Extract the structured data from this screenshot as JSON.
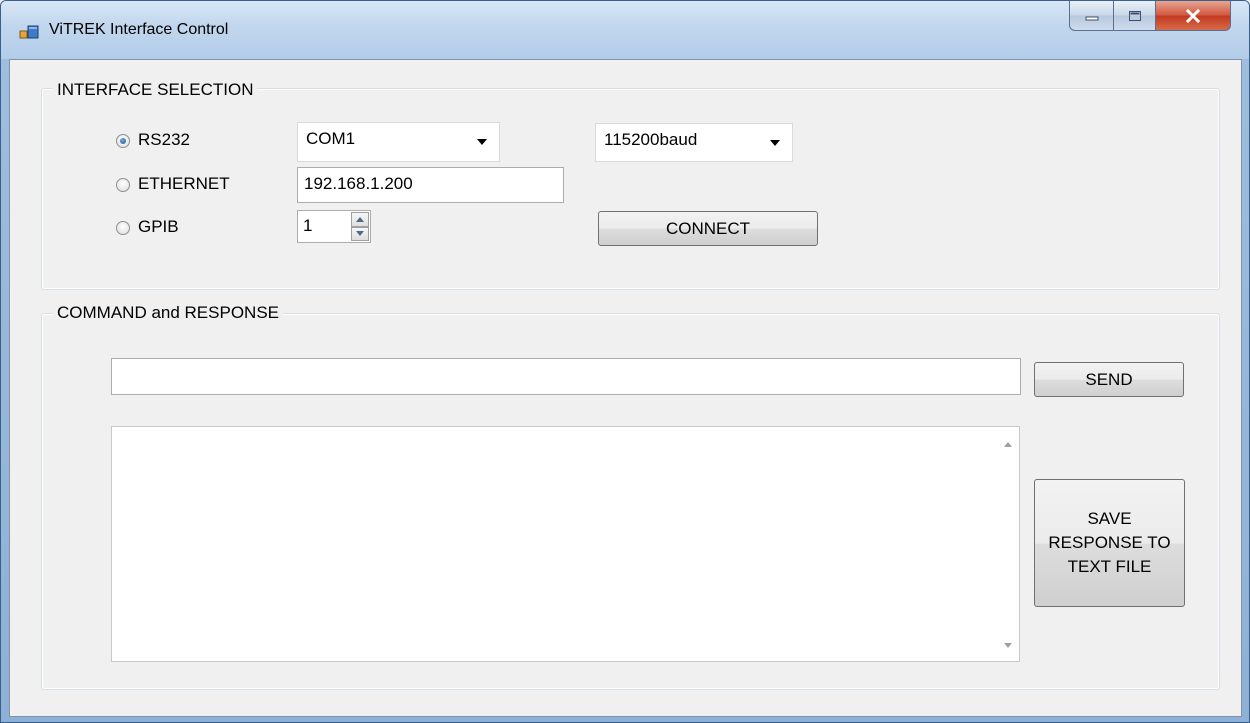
{
  "window": {
    "title": "ViTREK Interface Control",
    "accent_color": "#3a5f8a",
    "close_color": "#c23a1f"
  },
  "interface_selection": {
    "legend": "INTERFACE SELECTION",
    "rs232": {
      "label": "RS232",
      "checked": true,
      "port": "COM1",
      "baud": "115200baud"
    },
    "ethernet": {
      "label": "ETHERNET",
      "checked": false,
      "ip": "192.168.1.200"
    },
    "gpib": {
      "label": "GPIB",
      "checked": false,
      "address": "1"
    },
    "connect_label": "CONNECT"
  },
  "command_response": {
    "legend": "COMMAND and RESPONSE",
    "command_value": "",
    "send_label": "SEND",
    "response_text": "",
    "save_label": "SAVE RESPONSE TO TEXT FILE"
  }
}
